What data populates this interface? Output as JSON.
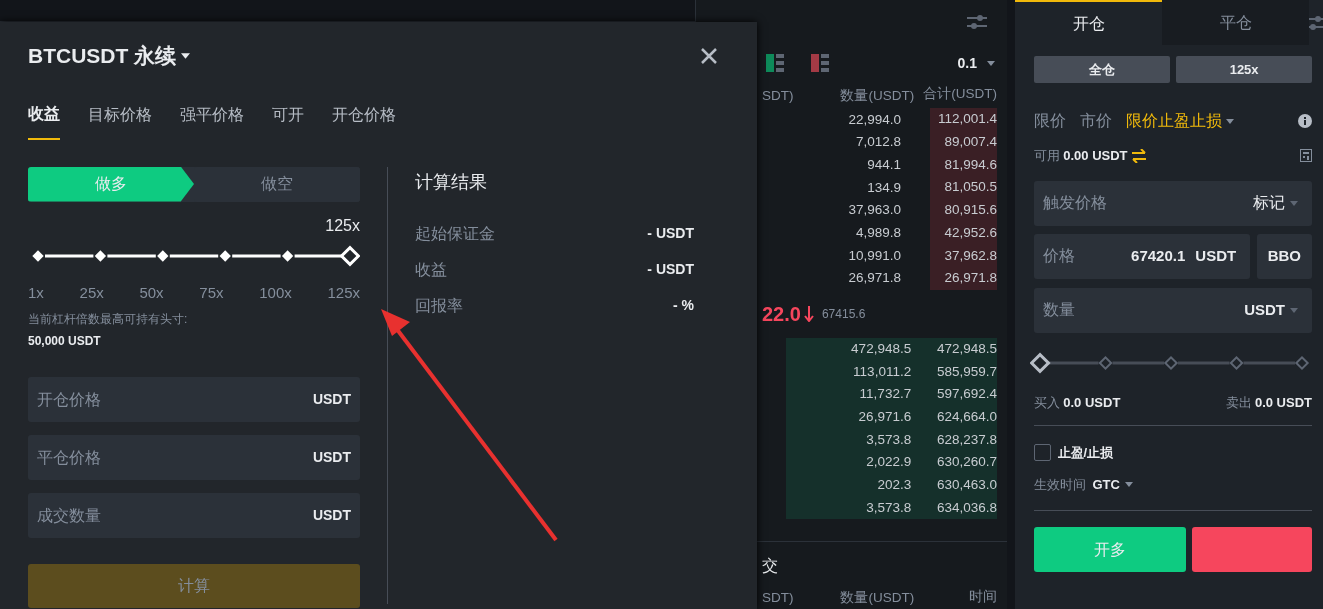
{
  "modal": {
    "title": "BTCUSDT 永续",
    "tabs": [
      {
        "label": "收益",
        "selected": true
      },
      {
        "label": "目标价格",
        "selected": false
      },
      {
        "label": "强平价格",
        "selected": false
      },
      {
        "label": "可开",
        "selected": false
      },
      {
        "label": "开仓价格",
        "selected": false
      }
    ],
    "sides": [
      {
        "label": "做多",
        "selected": true
      },
      {
        "label": "做空",
        "selected": false
      }
    ],
    "leverage": {
      "value": "125x",
      "level": 1,
      "ticks": [
        "1x",
        "25x",
        "50x",
        "75x",
        "100x",
        "125x"
      ]
    },
    "note": "当前杠杆倍数最高可持有头寸:",
    "max_position": "50,000 USDT",
    "fields": [
      {
        "placeholder": "开仓价格",
        "unit": "USDT"
      },
      {
        "placeholder": "平仓价格",
        "unit": "USDT"
      },
      {
        "placeholder": "成交数量",
        "unit": "USDT"
      }
    ],
    "calculate_button": {
      "label": "计算",
      "disabled": true
    },
    "results": {
      "title": "计算结果",
      "rows": [
        {
          "label": "起始保证金",
          "value": "- USDT"
        },
        {
          "label": "收益",
          "value": "- USDT"
        },
        {
          "label": "回报率",
          "value": "- %"
        }
      ]
    }
  },
  "order_book": {
    "precision": "0.1",
    "headers": [
      "SDT)",
      "数量(USDT)",
      "合计(USDT)"
    ],
    "asks": [
      {
        "amount": "22,994.0",
        "total": "112,001.4"
      },
      {
        "amount": "7,012.8",
        "total": "89,007.4"
      },
      {
        "amount": "944.1",
        "total": "81,994.6"
      },
      {
        "amount": "134.9",
        "total": "81,050.5"
      },
      {
        "amount": "37,963.0",
        "total": "80,915.6"
      },
      {
        "amount": "4,989.8",
        "total": "42,952.6"
      },
      {
        "amount": "10,991.0",
        "total": "37,962.8"
      },
      {
        "amount": "26,971.8",
        "total": "26,971.8"
      }
    ],
    "last_price": "22.0",
    "mark_price": "67415.6",
    "bids": [
      {
        "amount": "472,948.5",
        "total": "472,948.5"
      },
      {
        "amount": "113,011.2",
        "total": "585,959.7"
      },
      {
        "amount": "11,732.7",
        "total": "597,692.4"
      },
      {
        "amount": "26,971.6",
        "total": "624,664.0"
      },
      {
        "amount": "3,573.8",
        "total": "628,237.8"
      },
      {
        "amount": "2,022.9",
        "total": "630,260.7"
      },
      {
        "amount": "202.3",
        "total": "630,463.0"
      },
      {
        "amount": "3,573.8",
        "total": "634,036.8"
      }
    ]
  },
  "trades": {
    "title": "交",
    "headers": [
      "SDT)",
      "数量(USDT)",
      "时间"
    ]
  },
  "order_panel": {
    "tabs": [
      {
        "label": "开仓",
        "selected": true
      },
      {
        "label": "平仓",
        "selected": false
      }
    ],
    "margin_buttons": [
      "全仓",
      "125x"
    ],
    "order_types": [
      {
        "label": "限价",
        "selected": false
      },
      {
        "label": "市价",
        "selected": false
      },
      {
        "label": "限价止盈止损",
        "selected": true
      }
    ],
    "available": {
      "label": "可用",
      "value": "0.00 USDT"
    },
    "trigger": {
      "placeholder": "触发价格",
      "type": "标记"
    },
    "price": {
      "placeholder": "价格",
      "value": "67420.1",
      "unit": "USDT",
      "button": "BBO"
    },
    "quantity": {
      "placeholder": "数量",
      "unit": "USDT"
    },
    "slider": {
      "level": 0
    },
    "buy": {
      "label": "买入",
      "value": "0.0 USDT"
    },
    "sell": {
      "label": "卖出",
      "value": "0.0 USDT"
    },
    "tpsl": {
      "label": "止盈/止损",
      "checked": false
    },
    "time_in_force": {
      "label": "生效时间",
      "value": "GTC"
    },
    "actions": [
      {
        "kind": "long",
        "label": "开多"
      },
      {
        "kind": "short"
      }
    ]
  }
}
